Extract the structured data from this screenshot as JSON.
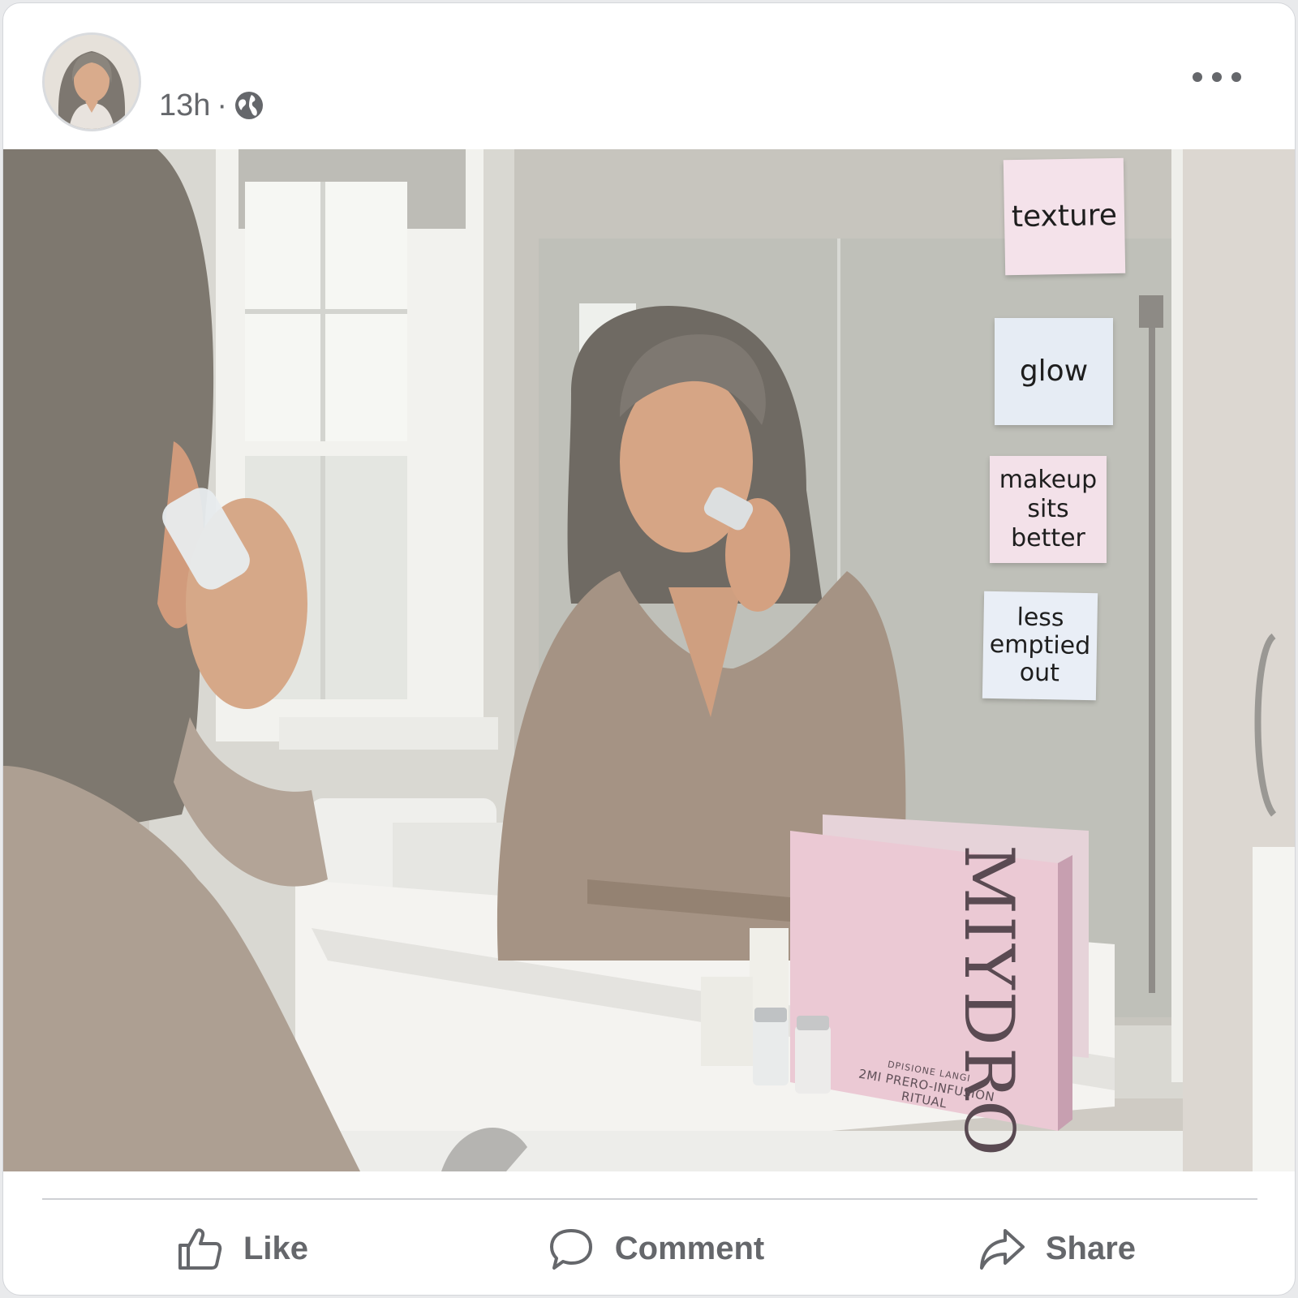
{
  "post": {
    "timestamp": "13h",
    "separator": "·",
    "audience_icon": "globe-icon",
    "menu_icon": "more-options-icon"
  },
  "photo": {
    "sticky_notes": [
      {
        "text": "texture"
      },
      {
        "text": "glow"
      },
      {
        "text": "makeup\nsits better"
      },
      {
        "text": "less\nemptied\nout"
      }
    ],
    "product_box": {
      "brand": "MIYDRO",
      "tagline_small": "DPISIONE LANGI",
      "tagline": "2MI PRERO-INFUSION RITUAL"
    }
  },
  "actions": {
    "like": {
      "label": "Like",
      "icon": "thumbs-up-icon"
    },
    "comment": {
      "label": "Comment",
      "icon": "comment-bubble-icon"
    },
    "share": {
      "label": "Share",
      "icon": "share-arrow-icon"
    }
  },
  "colors": {
    "text_secondary": "#65676b",
    "note_pink": "#f4e2ea",
    "note_blue": "#e6ecf4",
    "box_pink": "#e9c8d3",
    "divider": "#ced0d4"
  }
}
